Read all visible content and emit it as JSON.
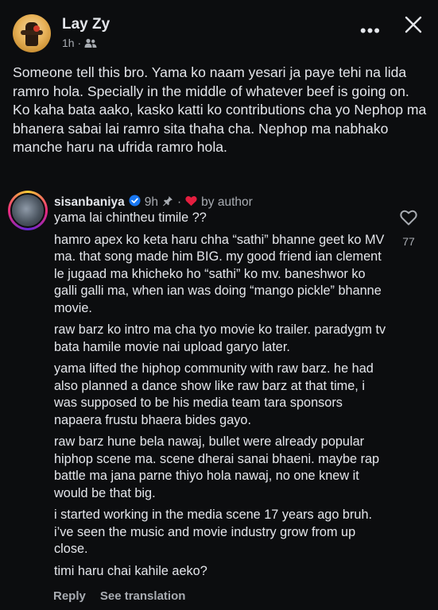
{
  "post": {
    "author": "Lay Zy",
    "time": "1h ·",
    "audience_icon": "friends-icon",
    "paragraphs": [
      "Someone tell this bro. Yama ko naam yesari ja paye tehi na lida ramro hola. Specially in the middle of whatever beef is going on.",
      "Ko kaha bata aako, kasko katti ko contributions cha yo Nephop ma bhanera sabai lai ramro sita thaha cha. Nephop ma nabhako manche haru na ufrida ramro hola."
    ]
  },
  "header": {
    "more_label": "•••",
    "close_icon": "close-icon"
  },
  "comment": {
    "username": "sisanbaniya",
    "time": "9h",
    "by_author_label": "by author",
    "like_count": "77",
    "paragraphs": [
      "yama lai chintheu timile ??",
      "hamro apex ko keta haru chha “sathi” bhanne geet ko MV ma. that song made him BIG. my good friend ian clement le jugaad ma khicheko ho “sathi” ko mv. baneshwor ko galli galli ma, when ian was doing “mango pickle” bhanne movie.",
      "raw barz ko intro ma cha tyo movie ko trailer. paradygm tv bata hamile movie nai upload garyo later.",
      "yama lifted the hiphop community with raw barz. he had also planned a dance show like raw barz at that time, i was supposed to be his media team tara sponsors napaera frustu bhaera bides gayo.",
      "raw barz hune bela nawaj, bullet were already popular hiphop scene ma. scene dherai sanai bhaeni. maybe rap battle ma jana parne thiyo hola nawaj, no one knew it would be that big.",
      "i started working in the media scene 17 years ago bruh. i’ve seen the music and movie industry grow from up close.",
      "timi haru chai kahile aeko?"
    ]
  },
  "actions": {
    "reply": "Reply",
    "see_translation": "See translation"
  },
  "colors": {
    "background": "#0c0d0f",
    "text": "#e4e6eb",
    "muted": "#a8acb2",
    "verified": "#1877f2",
    "heart": "#e41e3f"
  }
}
